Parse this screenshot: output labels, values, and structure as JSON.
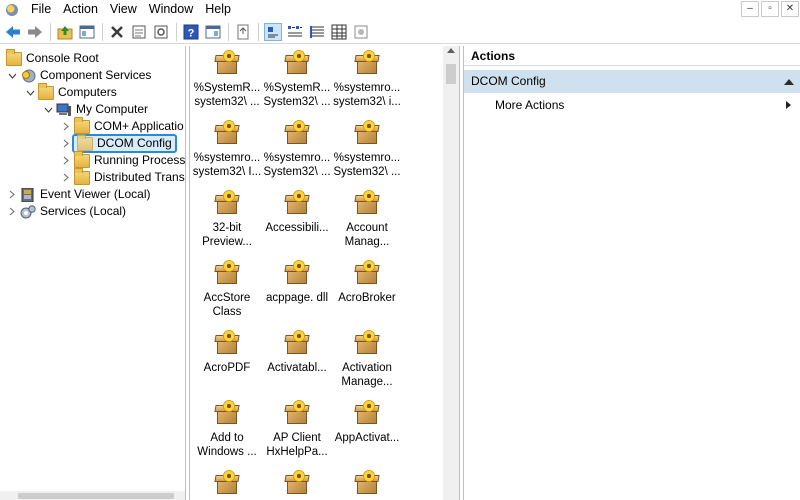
{
  "menu": [
    "File",
    "Action",
    "View",
    "Window",
    "Help"
  ],
  "window_controls": {
    "minimize": "–",
    "restore": "▫",
    "close": "✕"
  },
  "toolbar": {
    "buttons": [
      "back-icon",
      "forward-icon",
      "up-folder-icon",
      "show-hide-tree-icon",
      "delete-icon",
      "properties-icon",
      "refresh-icon",
      "help-icon",
      "view-icon",
      "export-list-icon",
      "large-icons-view-icon",
      "small-icons-view-icon",
      "list-view-icon",
      "detail-view-icon",
      "configure-icon"
    ]
  },
  "tree": [
    {
      "label": "Console Root",
      "level": 0,
      "icon": "folder-icon",
      "twisty": ""
    },
    {
      "label": "Component Services",
      "level": 1,
      "icon": "component-services-icon",
      "twisty": "˅"
    },
    {
      "label": "Computers",
      "level": 2,
      "icon": "folder-icon",
      "twisty": "˅"
    },
    {
      "label": "My Computer",
      "level": 3,
      "icon": "computer-icon",
      "twisty": "˅"
    },
    {
      "label": "COM+ Applicatio",
      "level": 4,
      "icon": "folder-icon",
      "twisty": "›"
    },
    {
      "label": "DCOM Config",
      "level": 4,
      "icon": "folder-icon",
      "twisty": "›",
      "selected": true
    },
    {
      "label": "Running Processe",
      "level": 4,
      "icon": "folder-icon",
      "twisty": "›"
    },
    {
      "label": "Distributed Transa",
      "level": 4,
      "icon": "folder-icon",
      "twisty": "›"
    },
    {
      "label": "Event Viewer (Local)",
      "level": 1,
      "icon": "event-viewer-icon",
      "twisty": "›"
    },
    {
      "label": "Services (Local)",
      "level": 1,
      "icon": "services-icon",
      "twisty": "›"
    }
  ],
  "items": [
    [
      "%SystemR...",
      "system32\\ ..."
    ],
    [
      "%SystemR...",
      "System32\\ ..."
    ],
    [
      "%systemro...",
      "system32\\ i..."
    ],
    [
      "%systemro...",
      "system32\\ I..."
    ],
    [
      "%systemro...",
      "System32\\ ..."
    ],
    [
      "%systemro...",
      "System32\\ ..."
    ],
    [
      "32-bit",
      "Preview..."
    ],
    [
      "Accessibili...",
      ""
    ],
    [
      "Account",
      "Manag..."
    ],
    [
      "AccStore",
      "Class"
    ],
    [
      "acppage. dll",
      ""
    ],
    [
      "AcroBroker",
      ""
    ],
    [
      "AcroPDF",
      ""
    ],
    [
      "Activatabl...",
      ""
    ],
    [
      "Activation",
      "Manage..."
    ],
    [
      "Add to",
      "Windows ..."
    ],
    [
      "AP Client",
      "HxHelpPa..."
    ],
    [
      "AppActivat...",
      ""
    ],
    [
      "",
      ""
    ],
    [
      "",
      ""
    ],
    [
      "",
      ""
    ]
  ],
  "actions": {
    "header": "Actions",
    "section": "DCOM Config",
    "items": [
      "More Actions"
    ]
  }
}
